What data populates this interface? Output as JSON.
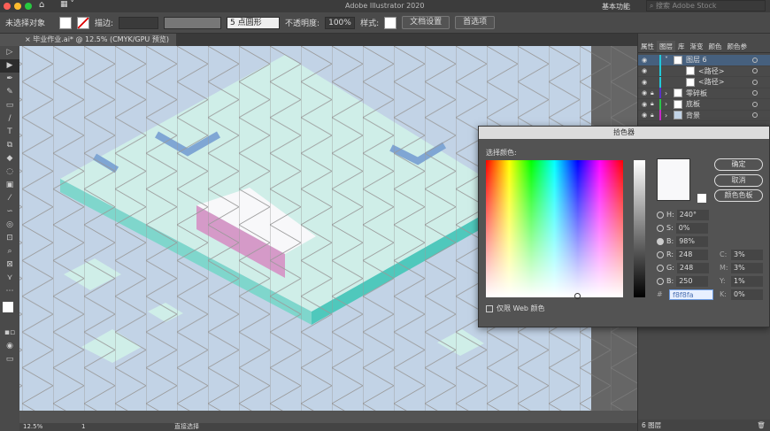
{
  "app": {
    "title": "Adobe Illustrator 2020",
    "workspace": "基本功能",
    "search_placeholder": "搜索 Adobe Stock"
  },
  "control_bar": {
    "selection": "未选择对象",
    "stroke_label": "描边:",
    "brush": "5 点圆形",
    "opacity_label": "不透明度:",
    "opacity": "100%",
    "style_label": "样式:",
    "doc_setup": "文档设置",
    "prefs": "首选项"
  },
  "document_tab": "毕业作业.ai* @ 12.5% (CMYK/GPU 预览)",
  "status": {
    "zoom": "12.5%",
    "page": "1",
    "tool": "直接选择"
  },
  "panel": {
    "tabs": [
      "属性",
      "图层",
      "库",
      "渐变",
      "颜色",
      "颜色参"
    ],
    "active_tab": 1,
    "layers": [
      {
        "name": "图层 6",
        "color": "#22c8d8",
        "level": 0,
        "locked": false,
        "selected": true
      },
      {
        "name": "<路径>",
        "color": "#22c8d8",
        "level": 1,
        "locked": false
      },
      {
        "name": "<路径>",
        "color": "#22c8d8",
        "level": 1,
        "locked": false
      },
      {
        "name": "零碎板",
        "color": "#5a32c8",
        "level": 0,
        "locked": true
      },
      {
        "name": "底板",
        "color": "#28c84a",
        "level": 0,
        "locked": true
      },
      {
        "name": "背景",
        "color": "#c828c8",
        "level": 0,
        "locked": true
      }
    ],
    "layer_count": "6 图层"
  },
  "color_picker": {
    "title": "拾色器",
    "select_label": "选择颜色:",
    "ok": "确定",
    "cancel": "取消",
    "swatches": "颜色色板",
    "web_only": "仅限 Web 颜色",
    "H": "240°",
    "S": "0%",
    "B": "98%",
    "R": "248",
    "G": "248",
    "B2": "250",
    "hex": "f8f8fa",
    "C": "3%",
    "M": "3%",
    "Y": "1%",
    "K": "0%",
    "labels": {
      "H": "H:",
      "S": "S:",
      "B": "B:",
      "R": "R:",
      "G": "G:",
      "B2": "B:",
      "C": "C:",
      "M": "M:",
      "Y": "Y:",
      "K": "K:",
      "hash": "#"
    },
    "selected_color": "#f8f8fa"
  }
}
